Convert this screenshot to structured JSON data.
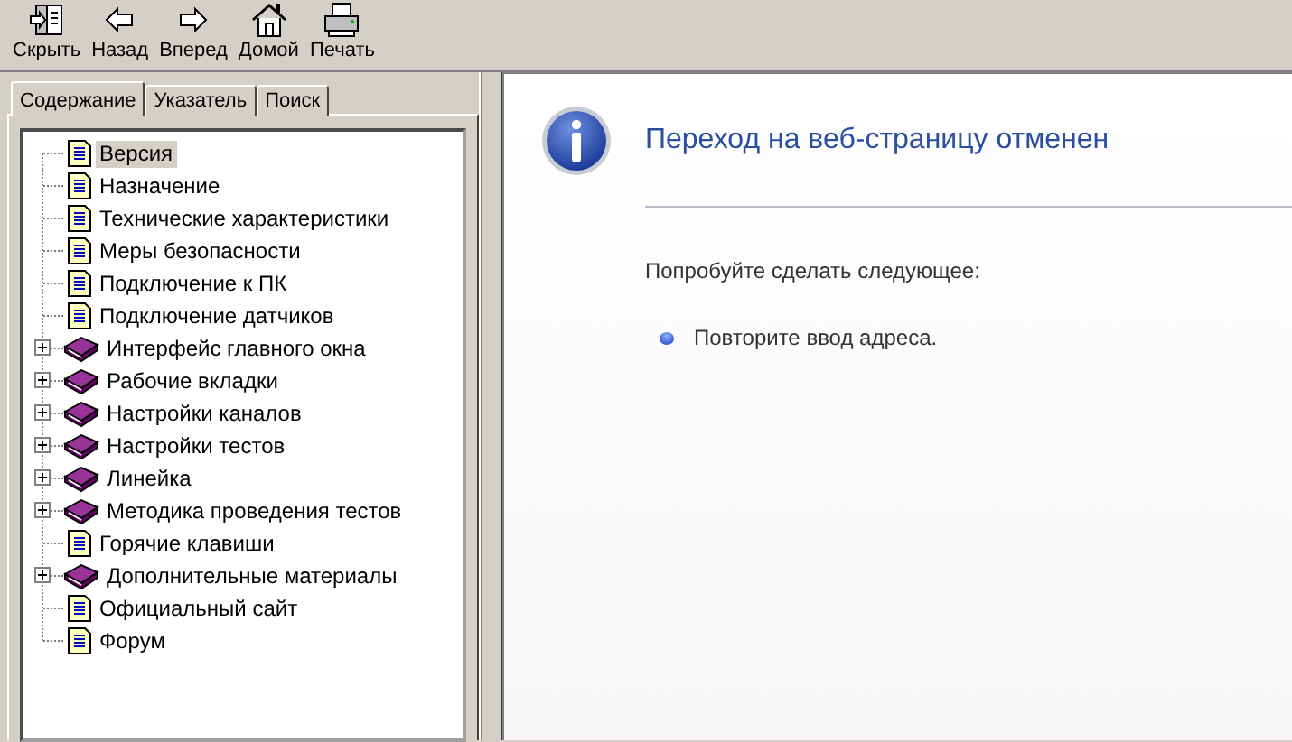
{
  "toolbar": [
    {
      "kind": "hide",
      "label": "Скрыть"
    },
    {
      "kind": "back",
      "label": "Назад"
    },
    {
      "kind": "forward",
      "label": "Вперед"
    },
    {
      "kind": "home",
      "label": "Домой"
    },
    {
      "kind": "print",
      "label": "Печать"
    }
  ],
  "tabs": [
    {
      "label": "Содержание",
      "selected": true
    },
    {
      "label": "Указатель",
      "selected": false
    },
    {
      "label": "Поиск",
      "selected": false
    }
  ],
  "tree": [
    {
      "kind": "page",
      "label": "Версия",
      "selected": true
    },
    {
      "kind": "page",
      "label": "Назначение",
      "selected": false
    },
    {
      "kind": "page",
      "label": "Технические характеристики",
      "selected": false
    },
    {
      "kind": "page",
      "label": "Меры безопасности",
      "selected": false
    },
    {
      "kind": "page",
      "label": "Подключение к ПК",
      "selected": false
    },
    {
      "kind": "page",
      "label": "Подключение датчиков",
      "selected": false
    },
    {
      "kind": "book",
      "label": "Интерфейс главного окна",
      "selected": false,
      "expanded": false
    },
    {
      "kind": "book",
      "label": "Рабочие вкладки",
      "selected": false,
      "expanded": false
    },
    {
      "kind": "book",
      "label": "Настройки каналов",
      "selected": false,
      "expanded": false
    },
    {
      "kind": "book",
      "label": "Настройки тестов",
      "selected": false,
      "expanded": false
    },
    {
      "kind": "book",
      "label": "Линейка",
      "selected": false,
      "expanded": false
    },
    {
      "kind": "book",
      "label": "Методика проведения тестов",
      "selected": false,
      "expanded": false
    },
    {
      "kind": "page",
      "label": "Горячие клавиши",
      "selected": false
    },
    {
      "kind": "book",
      "label": "Дополнительные материалы",
      "selected": false,
      "expanded": false
    },
    {
      "kind": "page",
      "label": "Официальный сайт",
      "selected": false
    },
    {
      "kind": "page",
      "label": "Форум",
      "selected": false
    }
  ],
  "content": {
    "title": "Переход на веб-страницу отменен",
    "intro": "Попробуйте сделать следующее:",
    "suggestions": [
      "Повторите ввод адреса."
    ]
  }
}
